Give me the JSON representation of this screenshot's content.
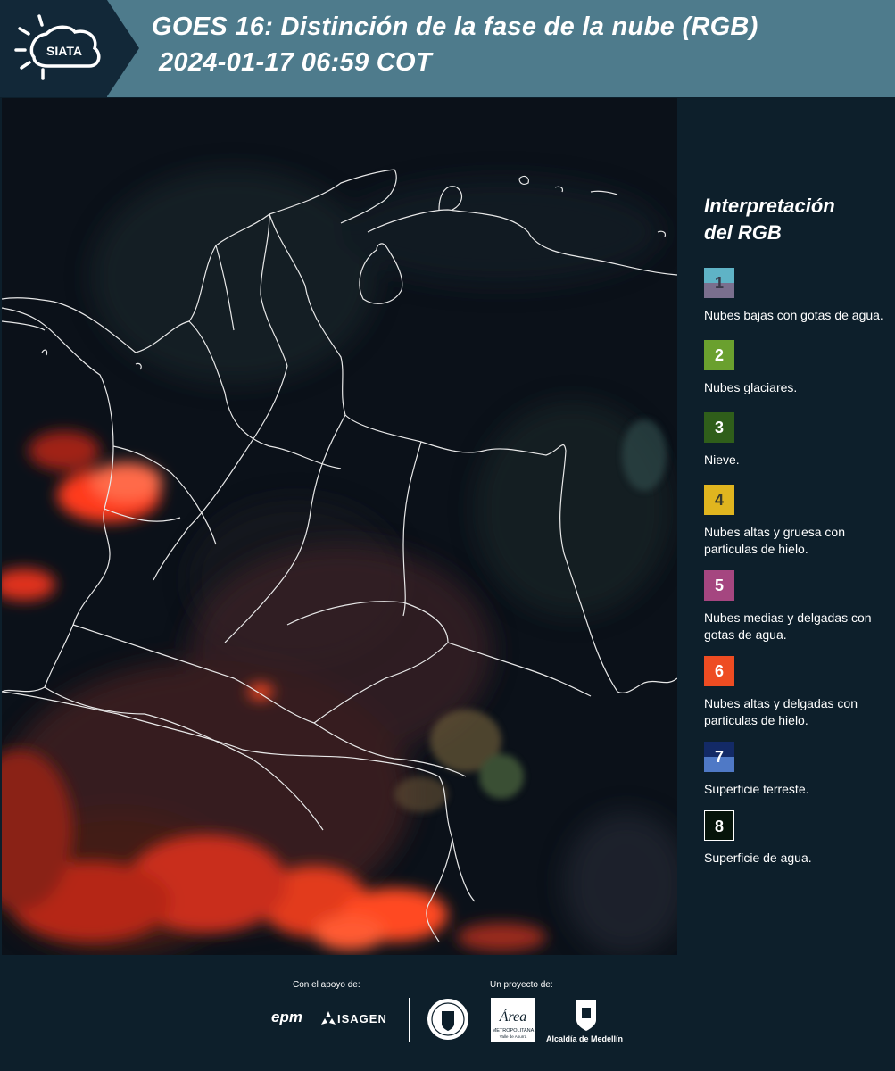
{
  "header": {
    "logo_text": "SIATA",
    "title_line1": "GOES 16: Distinción de la fase de la nube (RGB)",
    "title_line2": "2024-01-17 06:59 COT"
  },
  "legend": {
    "title_line1": "Interpretación",
    "title_line2": "del RGB",
    "items": [
      {
        "num": "1",
        "label": "Nubes bajas con gotas de agua.",
        "color_top": "#5fb3c6",
        "color_bottom": "#7a6f8e"
      },
      {
        "num": "2",
        "label": "Nubes glaciares.",
        "color": "#6aa02e"
      },
      {
        "num": "3",
        "label": "Nieve.",
        "color": "#2f5e1a"
      },
      {
        "num": "4",
        "label": "Nubes altas y gruesa con particulas de hielo.",
        "color": "#e0b51f"
      },
      {
        "num": "5",
        "label": "Nubes medias y delgadas con gotas de agua.",
        "color": "#a54680"
      },
      {
        "num": "6",
        "label": "Nubes altas y delgadas con particulas de hielo.",
        "color": "#ee4c22"
      },
      {
        "num": "7",
        "label": "Superficie terreste.",
        "color_top": "#132a66",
        "color_bottom": "#4f79c6"
      },
      {
        "num": "8",
        "label": "Superficie de agua.",
        "color": "#06140a"
      }
    ]
  },
  "footer": {
    "support_label": "Con el apoyo de:",
    "project_label": "Un proyecto de:",
    "sponsor_1": "epm",
    "sponsor_2": "ISAGEN",
    "partner_1": "METROPOLITANA",
    "partner_1_sub": "Valle de Aburrá",
    "partner_2": "Alcaldía de Medellín"
  }
}
